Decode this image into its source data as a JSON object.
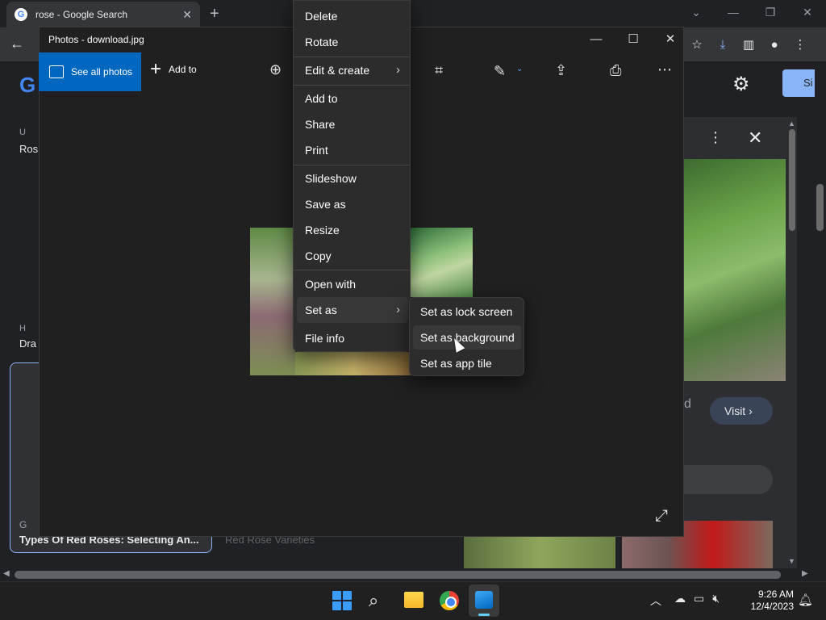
{
  "browser": {
    "tab_title": "rose - Google Search",
    "favicon_letter": "G",
    "signin_label": "Si"
  },
  "google_page": {
    "left_snip_1_source": "U",
    "left_snip_1_title": "Ros",
    "left_snip_2_source": "H",
    "left_snip_2_title": "Dra",
    "left_card_source": "G",
    "left_card_title": "Types Of Red Roses: Selecting An...",
    "mid_card_title": "Red Rose Varieties",
    "side_panel_title_fragment": "d",
    "visit_label": "Visit"
  },
  "photos_app": {
    "window_title": "Photos - download.jpg",
    "see_all_photos": "See all photos",
    "add_to": "Add to"
  },
  "context_menu": {
    "items": [
      {
        "label": "Delete"
      },
      {
        "label": "Rotate"
      },
      {
        "label": "Edit & create"
      },
      {
        "label": "Add to"
      },
      {
        "label": "Share"
      },
      {
        "label": "Print"
      },
      {
        "label": "Slideshow"
      },
      {
        "label": "Save as"
      },
      {
        "label": "Resize"
      },
      {
        "label": "Copy"
      },
      {
        "label": "Open with"
      },
      {
        "label": "Set as"
      },
      {
        "label": "File info"
      }
    ],
    "highlighted": "Set as"
  },
  "submenu": {
    "items": [
      {
        "label": "Set as lock screen"
      },
      {
        "label": "Set as background"
      },
      {
        "label": "Set as app tile"
      }
    ],
    "highlighted": "Set as background"
  },
  "taskbar": {
    "time": "9:26 AM",
    "date": "12/4/2023",
    "active_app": "Photos"
  },
  "colors": {
    "photos_accent": "#0067c0",
    "menu_bg": "#2c2c2c",
    "taskbar_bg": "#202020",
    "google_dark_bg": "#202124"
  }
}
